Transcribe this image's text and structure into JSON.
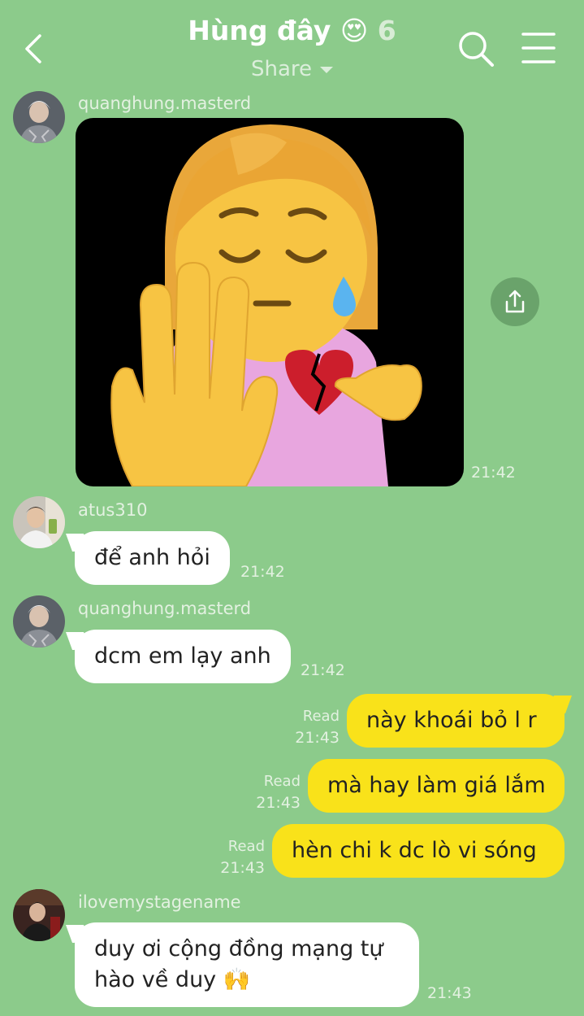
{
  "header": {
    "title": "Hùng đây 😍",
    "member_count": "6",
    "share_label": "Share",
    "icons": [
      "back-icon",
      "search-icon",
      "menu-icon"
    ]
  },
  "messages": [
    {
      "sender": "quanghung.masterd",
      "type": "sticker",
      "time": "21:42"
    },
    {
      "sender": "atus310",
      "text": "để anh hỏi",
      "time": "21:42"
    },
    {
      "sender": "quanghung.masterd",
      "text": "dcm em lạy anh",
      "time": "21:42"
    },
    {
      "outgoing": true,
      "status": "Read",
      "text": "này khoái bỏ l  r",
      "time": "21:43"
    },
    {
      "outgoing": true,
      "status": "Read",
      "text": "mà hay làm giá lắm",
      "time": "21:43"
    },
    {
      "outgoing": true,
      "status": "Read",
      "text": "hèn chi k dc lò vi sóng",
      "time": "21:43"
    },
    {
      "sender": "ilovemystagename",
      "text_line1": "duy ơi cộng đồng mạng tự",
      "text_line2": "hào về duy 🙌",
      "time": "21:43"
    }
  ],
  "colors": {
    "background": "#8ccb8b",
    "outgoing_bubble": "#f9e21a",
    "incoming_bubble": "#ffffff"
  }
}
